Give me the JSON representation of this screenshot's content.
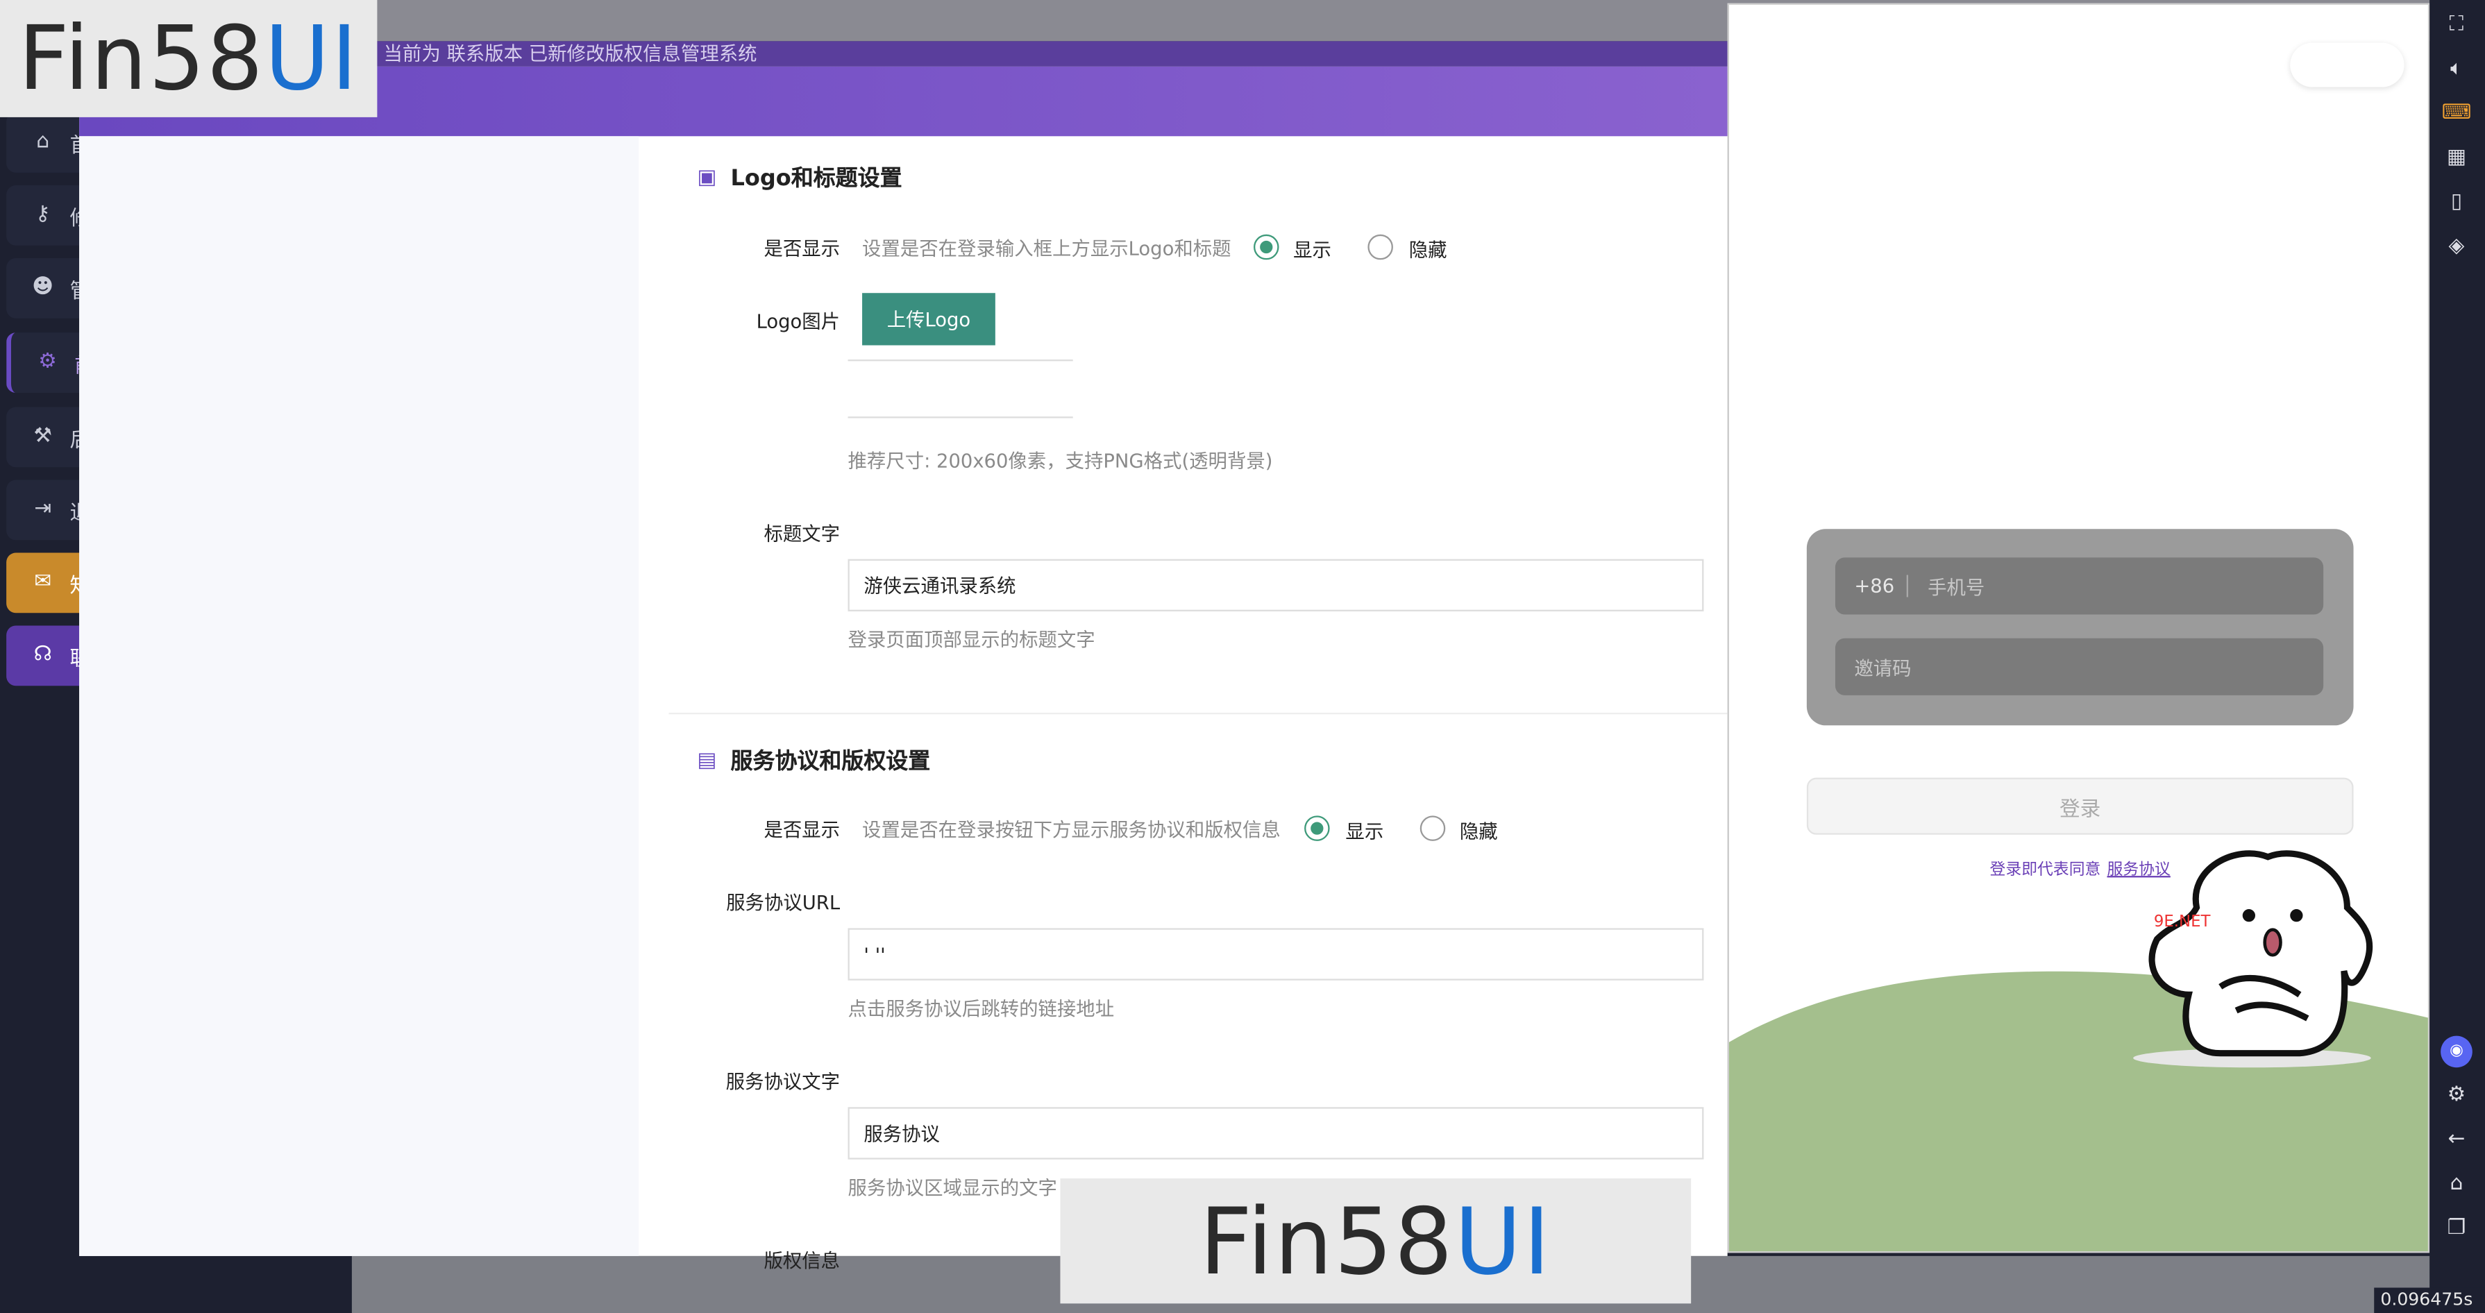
{
  "watermark": {
    "part1": "Fin58",
    "part2": "UI"
  },
  "sidebar": {
    "items": [
      {
        "icon": "home-icon",
        "glyph": "⌂",
        "label": "首"
      },
      {
        "icon": "key-icon",
        "glyph": "⚷",
        "label": "修"
      },
      {
        "icon": "users-icon",
        "glyph": "☻",
        "label": "管"
      },
      {
        "icon": "gear-icon",
        "glyph": "⚙",
        "label": "前"
      },
      {
        "icon": "wrench-icon",
        "glyph": "⚒",
        "label": "后"
      },
      {
        "icon": "logout-icon",
        "glyph": "⇥",
        "label": "退"
      },
      {
        "icon": "chat-icon",
        "glyph": "✉",
        "label": "知"
      },
      {
        "icon": "headset-icon",
        "glyph": "☊",
        "label": "联"
      }
    ]
  },
  "topbar": {
    "strip_text": "当前为                    联系版本    已新修改版权信息管理系统"
  },
  "form": {
    "section1_title": "Logo和标题设置",
    "show_label": "是否显示",
    "show_hint": "设置是否在登录输入框上方显示Logo和标题",
    "radio_show": "显示",
    "radio_hide": "隐藏",
    "logo_label": "Logo图片",
    "upload_btn": "上传Logo",
    "logo_hint": "推荐尺寸: 200x60像素，支持PNG格式(透明背景)",
    "title_label": "标题文字",
    "title_value": "游侠云通讯录系统",
    "title_hint": "登录页面顶部显示的标题文字",
    "section2_title": "服务协议和版权设置",
    "show2_label": "是否显示",
    "show2_hint": "设置是否在登录按钮下方显示服务协议和版权信息",
    "url_label": "服务协议URL",
    "url_value": "' ''",
    "url_hint": "点击服务协议后跳转的链接地址",
    "agreement_label": "服务协议文字",
    "agreement_value": "服务协议",
    "agreement_hint": "服务协议区域显示的文字",
    "copyright_label": "版权信息"
  },
  "preview": {
    "country_code": "+86",
    "phone_placeholder": "手机号",
    "code_placeholder": "邀请码",
    "login_btn": "登录",
    "agree_text": "登录即代表同意",
    "agree_link": "服务协议",
    "sticker_text": "9E.NET"
  },
  "toolbar": {
    "icons": [
      "fullscreen-icon",
      "volume-icon",
      "keyboard-icon",
      "apk-icon",
      "rotate-icon",
      "layers-icon",
      "discord-icon",
      "settings-icon",
      "back-icon",
      "home-icon",
      "recent-apps-icon"
    ]
  },
  "timer": "0.096475s",
  "colors": {
    "accent": "#6a48c0",
    "primary_btn": "#3a8f7f",
    "radio_on": "#3e9a7a",
    "lawn": "#a4bf8d"
  }
}
